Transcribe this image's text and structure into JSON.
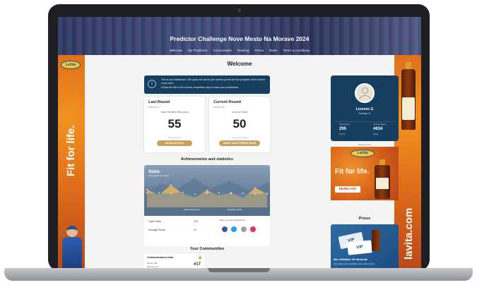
{
  "header": {
    "title": "Predictor Challenge Nove Mesto Na Morave 2024",
    "nav": [
      "Welcome",
      "My Prediction",
      "Communities",
      "Ranking",
      "Prizes",
      "Rules",
      "Terms & conditions"
    ]
  },
  "main": {
    "welcome": "Welcome",
    "info": {
      "line1": "This is your dashboard. Get quick info about your earned points and the progress of the current round here.",
      "line2": "Follow the link to the current competition day to make your predictions!"
    },
    "last_round": {
      "title": "Last Round",
      "date": "2024/02/27",
      "label": "Total Predicted Bib points",
      "value": "55",
      "note": "All results are",
      "button": "SHOW DETAILS"
    },
    "current_round": {
      "title": "Current Round",
      "date": "2024/02/28",
      "label": "Current Points",
      "value": "50",
      "note": "All current round",
      "button": "MAKE YOUR PREDICTIONS"
    },
    "achievements_title": "Achievements and statistics",
    "stats": {
      "title": "Stats",
      "subtitle": "Your points per round",
      "legend_1": "Points last round",
      "legend_2": "Average points",
      "total_label": "Total Points",
      "total_value": "275",
      "avg_label": "Average Points",
      "avg_value": "31",
      "share_label": "Share your accomplishment"
    },
    "communities_title": "Your Communities",
    "community": {
      "name": "Communications team",
      "row1": "Points 795",
      "row2": "Members 11",
      "rank": "#17"
    }
  },
  "profile": {
    "name": "Lorenzo G",
    "settings": "Settings ⚙",
    "total_label": "Total Score",
    "total_value": "295",
    "total_sub": "Points",
    "rank_label": "Current Rank",
    "rank_value": "#634",
    "rank_sub": "Rank"
  },
  "sponsor": {
    "label": "Sponsored by",
    "brand": "LaVita",
    "slogan": "Fit for life.",
    "url": "lavita.com"
  },
  "prizes": {
    "title": "Prizes",
    "ticket_label": "VIP",
    "text": "Win a Biathlon VIP Weekend!",
    "sub": "Just make your prediction and collect points"
  },
  "side_ads": {
    "left_text": "Fit for life.",
    "right_text": "lavita.com",
    "brand": "LaVita"
  },
  "chart_data": {
    "type": "area",
    "title": "Stats",
    "subtitle": "Your points per round",
    "series": [
      {
        "name": "Points last round",
        "color": "#e0b463",
        "values": [
          40,
          28,
          50,
          30,
          22,
          38,
          26,
          33,
          20,
          44,
          30
        ]
      },
      {
        "name": "Average points",
        "color": "#6f87a3",
        "values": [
          32,
          33,
          31,
          34,
          30,
          32,
          33,
          31,
          32,
          30,
          31
        ]
      }
    ],
    "ylim": [
      0,
      60
    ]
  },
  "colors": {
    "navy": "#163e5f",
    "gold": "#c9a15a",
    "orange": "#e2741f"
  }
}
